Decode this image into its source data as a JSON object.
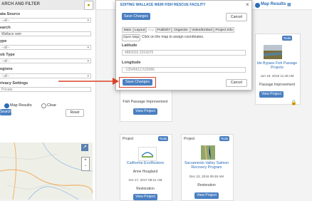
{
  "left_panel": {
    "title": "ARCH AND FILTER",
    "bulb_icon": "lightbulb-icon",
    "labels": {
      "location": "ata Source",
      "search": "earch",
      "type": "ype",
      "job_type": "ob Type",
      "regions": "egions",
      "privacy": "rivacy Settings"
    },
    "values": {
      "location": "--all--",
      "search": "Wallace weir",
      "type": "--all--",
      "job_type": "--all--",
      "regions": "--all--",
      "privacy": "Private"
    },
    "map_results_label": "Map Results",
    "clear_label": "Clear",
    "search_button": "Search",
    "reset_button": "Reset"
  },
  "topbar": {
    "map_results": "Map Results"
  },
  "cards": {
    "right_top": {
      "title": "Ide Bypass Fish Passage Projects",
      "date": "Jun 19, 2018 11:49 AM",
      "category": "Passage Improvement",
      "view": "View Project",
      "tools": "Tools"
    },
    "center_mid": {
      "category": "Fish Passage Improvement",
      "view": "View Project"
    },
    "bottom_left": {
      "label": "Project",
      "tools": "Tools",
      "title": "California EcoRestore",
      "person": "Anne Hoagland",
      "date": "Oct 17, 2017 09:21 AM",
      "category": "Restoration",
      "view": "View Project"
    },
    "bottom_right": {
      "label": "Project",
      "tools": "Tools",
      "title": "Sacramento Valley Salmon Recovery Program",
      "date": "Dec 23, 2016 09:48 AM",
      "category": "Restoration",
      "view": "View Project"
    }
  },
  "modal": {
    "title": "EDITING WALLACE WEIR FISH RESCUE FACILITY",
    "save_top": "Save Changes",
    "cancel_top": "Cancel",
    "tabs": [
      "Main",
      "Layout",
      "Map",
      "Publish?",
      "Organize",
      "Video/Embed",
      "Project Info"
    ],
    "open_map": "Open Map",
    "hint": "Click on the map to assign coordinates.",
    "latitude_label": "Latitude",
    "latitude_value": "4883332.2319376",
    "longitude_label": "Longitude",
    "longitude_value": "-13549612.529386",
    "save_bottom": "Save Changes",
    "cancel_bottom": "Cancel"
  },
  "annotation": {
    "color": "#d9432a"
  }
}
